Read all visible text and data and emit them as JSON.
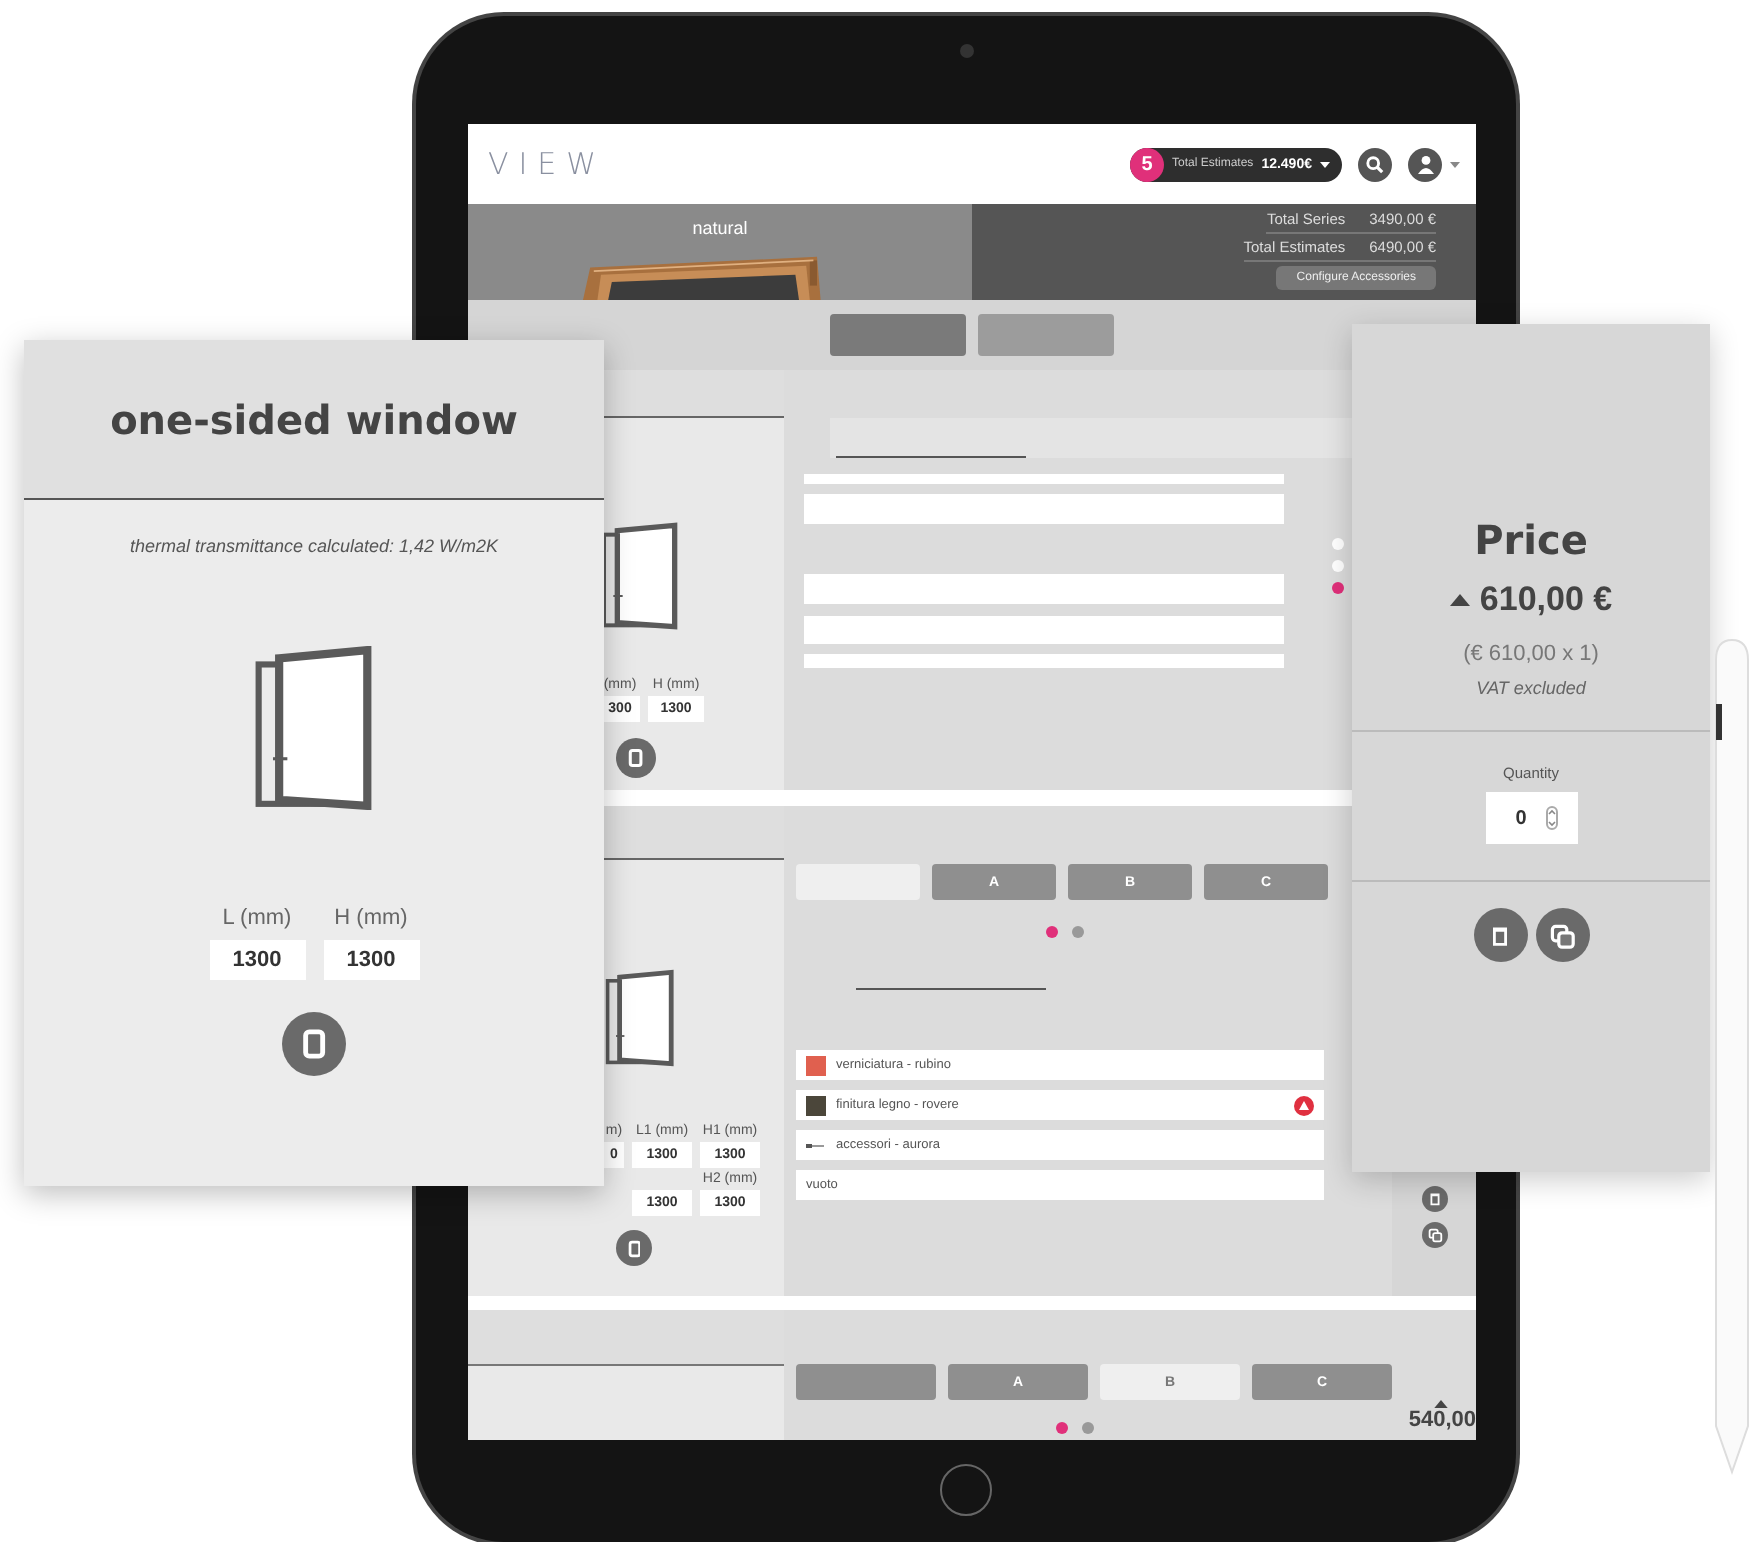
{
  "header": {
    "logo": "VIEW",
    "estimates_count": "5",
    "estimates_label": "Total Estimates",
    "estimates_total": "12.490€"
  },
  "banner": {
    "finish": "natural",
    "totals": [
      {
        "label": "Total Series",
        "value": "3490,00 €"
      },
      {
        "label": "Total Estimates",
        "value": "6490,00 €"
      }
    ],
    "button": "Configure Accessories"
  },
  "top_tabs": [
    {
      "selected": true
    },
    {
      "selected": false
    }
  ],
  "window_row": {
    "dims": [
      {
        "label": "(mm)",
        "value": "300"
      },
      {
        "label": "H (mm)",
        "value": "1300"
      }
    ],
    "pager": [
      {
        "selected": false
      },
      {
        "selected": false
      },
      {
        "selected": true
      }
    ]
  },
  "door_row": {
    "dims": [
      {
        "label": "m)",
        "value": "0"
      },
      {
        "label": "L1 (mm)",
        "value": "1300"
      },
      {
        "label": "H1 (mm)",
        "value": "1300"
      }
    ],
    "dims_2": [
      {
        "value": "1300"
      },
      {
        "label": "H2 (mm)",
        "value": "1300"
      }
    ],
    "tabs": [
      {
        "selected": true
      },
      {
        "label": "A",
        "selected": false
      },
      {
        "label": "B",
        "selected": false
      },
      {
        "label": "C",
        "selected": false
      }
    ],
    "pager": [
      {
        "selected": true
      },
      {
        "selected": false
      }
    ],
    "options": [
      {
        "kind": "swatch",
        "color": "#e0604f",
        "label": "verniciatura - rubino",
        "warning": false
      },
      {
        "kind": "swatch",
        "color": "#4b463a",
        "label": "finitura legno - rovere",
        "warning": true
      },
      {
        "kind": "accessory",
        "label": "accessori - aurora",
        "warning": false
      },
      {
        "kind": "empty",
        "label": "vuoto",
        "warning": false
      }
    ]
  },
  "third_row": {
    "tabs": [
      {
        "selected": false
      },
      {
        "label": "A",
        "selected": false
      },
      {
        "label": "B",
        "selected": true
      },
      {
        "label": "C",
        "selected": false
      }
    ],
    "pager": [
      {
        "selected": true
      },
      {
        "selected": false
      }
    ],
    "price": "540,00"
  },
  "spec_card": {
    "title": "one-sided window",
    "transmittance": "thermal transmittance calculated: 1,42 W/m2K",
    "dims": [
      {
        "label": "L (mm)",
        "value": "1300"
      },
      {
        "label": "H (mm)",
        "value": "1300"
      }
    ]
  },
  "price_card": {
    "title": "Price",
    "amount": "610,00 €",
    "breakdown": "(€ 610,00 x 1)",
    "vat_note": "VAT excluded",
    "quantity_label": "Quantity",
    "quantity": "0"
  }
}
